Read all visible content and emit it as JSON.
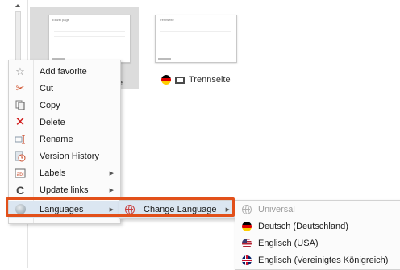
{
  "tiles": [
    {
      "title": "Einzel page",
      "label": "e"
    },
    {
      "title": "Trennseite",
      "label": "Trennseite",
      "flag": "flag-de",
      "icon": "page-icon"
    }
  ],
  "context_menu": {
    "items": [
      {
        "label": "Add favorite",
        "icon": "star-icon"
      },
      {
        "label": "Cut",
        "icon": "scissors-icon"
      },
      {
        "label": "Copy",
        "icon": "copy-icon"
      },
      {
        "label": "Delete",
        "icon": "delete-x-icon"
      },
      {
        "label": "Rename",
        "icon": "rename-icon"
      },
      {
        "label": "Version History",
        "icon": "version-history-icon"
      },
      {
        "label": "Labels",
        "icon": "labels-icon",
        "submenu": true
      },
      {
        "label": "Update links",
        "icon": "update-links-icon",
        "submenu": true
      },
      {
        "label": "Languages",
        "icon": "globe-icon",
        "submenu": true,
        "highlighted": true
      }
    ]
  },
  "languages_submenu": {
    "items": [
      {
        "label": "Change Language",
        "icon": "globe-icon",
        "submenu": true,
        "highlighted": true
      }
    ]
  },
  "change_language_submenu": {
    "items": [
      {
        "label": "Universal",
        "icon": "globe-icon",
        "disabled": true
      },
      {
        "label": "Deutsch (Deutschland)",
        "icon": "flag-germany-icon"
      },
      {
        "label": "Englisch (USA)",
        "icon": "flag-usa-icon"
      },
      {
        "label": "Englisch (Vereinigtes Königreich)",
        "icon": "flag-uk-icon"
      }
    ]
  },
  "colors": {
    "highlight_border": "#e2501a",
    "hover_bg": "#dbe6f1",
    "delete_red": "#d11a1a"
  }
}
